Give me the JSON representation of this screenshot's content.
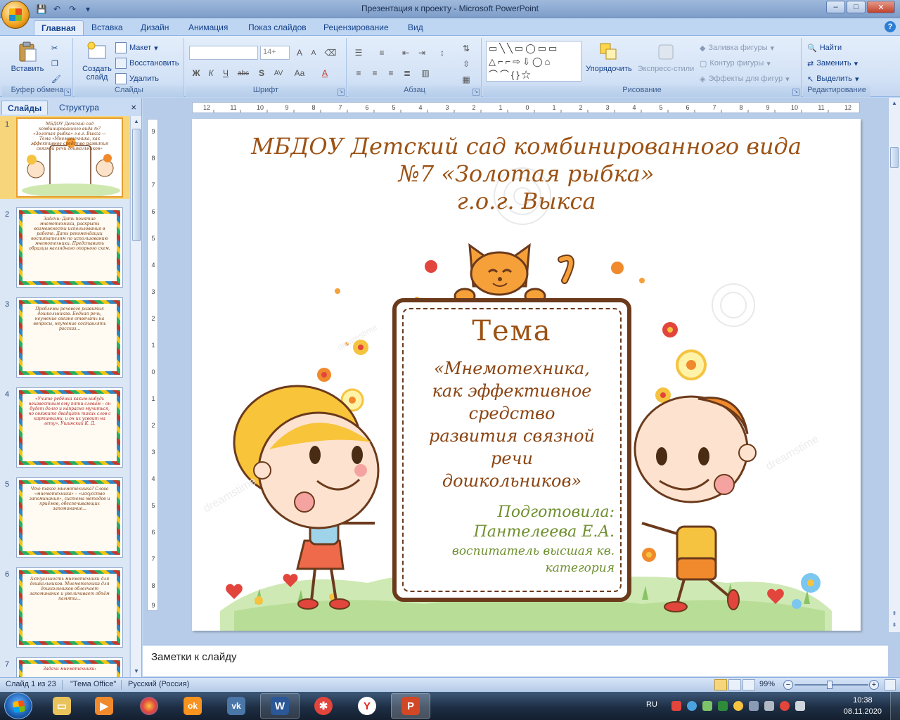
{
  "window": {
    "title": "Презентация к проекту - Microsoft PowerPoint",
    "controls": {
      "minimize": "–",
      "maximize": "□",
      "close": "✕"
    }
  },
  "qat": {
    "save": "💾",
    "undo": "↶",
    "redo": "↷",
    "more": "▾"
  },
  "ribbon": {
    "tabs": [
      "Главная",
      "Вставка",
      "Дизайн",
      "Анимация",
      "Показ слайдов",
      "Рецензирование",
      "Вид"
    ],
    "active_tab": "Главная",
    "clipboard": {
      "label": "Буфер обмена",
      "paste": "Вставить"
    },
    "slides": {
      "label": "Слайды",
      "new_slide": "Создать слайд",
      "layout": "Макет",
      "reset": "Восстановить",
      "delete": "Удалить"
    },
    "font": {
      "label": "Шрифт",
      "font_name": "",
      "font_size": "14+",
      "bold": "Ж",
      "italic": "К",
      "underline": "Ч",
      "strike": "abc",
      "shadow": "S",
      "spacing": "AV",
      "case": "Aa",
      "color": "A",
      "grow": "A",
      "shrink": "A"
    },
    "paragraph": {
      "label": "Абзац"
    },
    "drawing": {
      "label": "Рисование",
      "arrange": "Упорядочить",
      "quick_styles": "Экспресс-стили",
      "shape_fill": "Заливка фигуры",
      "shape_outline": "Контур фигуры",
      "shape_effects": "Эффекты для фигур"
    },
    "editing": {
      "label": "Редактирование",
      "find": "Найти",
      "replace": "Заменить",
      "select": "Выделить"
    }
  },
  "left_pane": {
    "tabs": [
      "Слайды",
      "Структура"
    ],
    "active_tab": "Слайды",
    "close": "×",
    "slides": [
      {
        "num": "1",
        "text": "МБДОУ Детский сад комбинированного вида №7 «Золотая рыбка» г.о.г. Выкса — Тема «Мнемотехника, как эффективное средство развития связной речи дошкольников»"
      },
      {
        "num": "2",
        "text": "Задачи: Дать понятие мнемотехники, раскрыть возможности использования в работе. Дать рекомендации воспитателям по использованию мнемотехники. Представить образцы наглядного опорного схем."
      },
      {
        "num": "3",
        "text": "Проблемы речевого развития дошкольников. Бедная речь, неумение связно отвечать на вопросы, неумение составлять рассказ..."
      },
      {
        "num": "4",
        "text": "«Учите ребёнка каким-нибудь неизвестным ему пяти словам – он будет долго и напрасно мучиться, но свяжите двадцать таких слов с картинками, и он их усвоит на лету». Ушинский К. Д."
      },
      {
        "num": "5",
        "text": "Что такое мнемотехника? Слово «мнемотехника» – «искусство запоминания», система методов и приёмов, обеспечивающих запоминание..."
      },
      {
        "num": "6",
        "text": "Актуальность мнемотехники для дошкольников. Мнемотехника для дошкольников облегчает запоминание и увеличивает объём памяти..."
      },
      {
        "num": "7",
        "text": "Задачи мнемотехники:"
      }
    ]
  },
  "slide": {
    "title_lines": [
      "МБДОУ Детский сад  комбинированного вида",
      "№7 «Золотая рыбка»",
      "г.о.г. Выкса"
    ],
    "heading": "Тема",
    "topic_lines": [
      "«Мнемотехника,",
      "как эффективное",
      "средство",
      "развития связной",
      "речи",
      "дошкольников»"
    ],
    "author": [
      "Подготовила:",
      "Пантелеева Е.А.",
      "воспитатель  высшая кв.",
      "категория"
    ],
    "watermark": "dreamstime"
  },
  "notes": {
    "placeholder": "Заметки к слайду"
  },
  "status": {
    "slide_info": "Слайд 1 из 23",
    "theme": "\"Тема Office\"",
    "language": "Русский (Россия)",
    "zoom": "99%",
    "zoom_minus": "−",
    "zoom_plus": "+"
  },
  "taskbar": {
    "lang": "RU",
    "time": "10:38",
    "date": "08.11.2020",
    "word_label": "W",
    "ok_label": "ok",
    "vk_label": "vk",
    "yandex_label": "Y"
  },
  "colors": {
    "slide_title": "#9c5214",
    "author": "#6f8f2f",
    "board": "#6b3a1c",
    "ribbon_text": "#15428b"
  }
}
